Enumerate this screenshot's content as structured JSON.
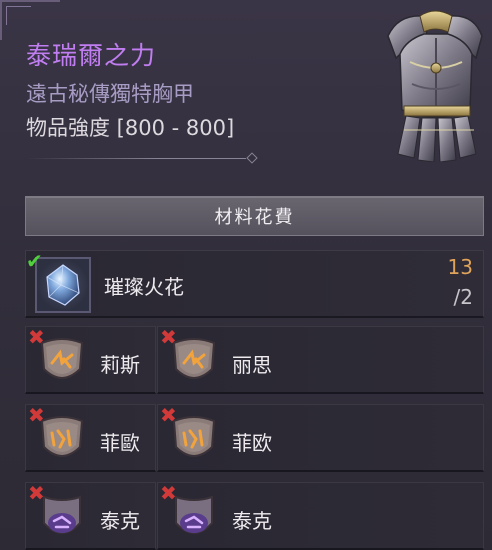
{
  "item": {
    "name": "泰瑞爾之力",
    "type": "遠古秘傳獨特胸甲",
    "power": "物品強度 [800 - 800]"
  },
  "costs": {
    "header": "材料花費",
    "main_material": {
      "name": "璀璨火花",
      "have": "13",
      "need": "/2",
      "satisfied": true
    },
    "runes": [
      {
        "left": "莉斯",
        "right": "丽思",
        "satisfied": false
      },
      {
        "left": "菲歐",
        "right": "菲欧",
        "satisfied": false
      },
      {
        "left": "泰克",
        "right": "泰克",
        "satisfied": false
      }
    ]
  },
  "colors": {
    "title": "#c07ef0",
    "subtitle": "#a79cc4",
    "count_have": "#e0a35a",
    "check": "#4fd03c",
    "cross": "#d23a3a"
  },
  "icons": {
    "check": "checkmark-icon",
    "cross": "red-x-icon",
    "main_material": "radiant-spark-icon",
    "rune_orange": "orange-rune-icon",
    "rune_purple": "purple-rune-icon"
  }
}
